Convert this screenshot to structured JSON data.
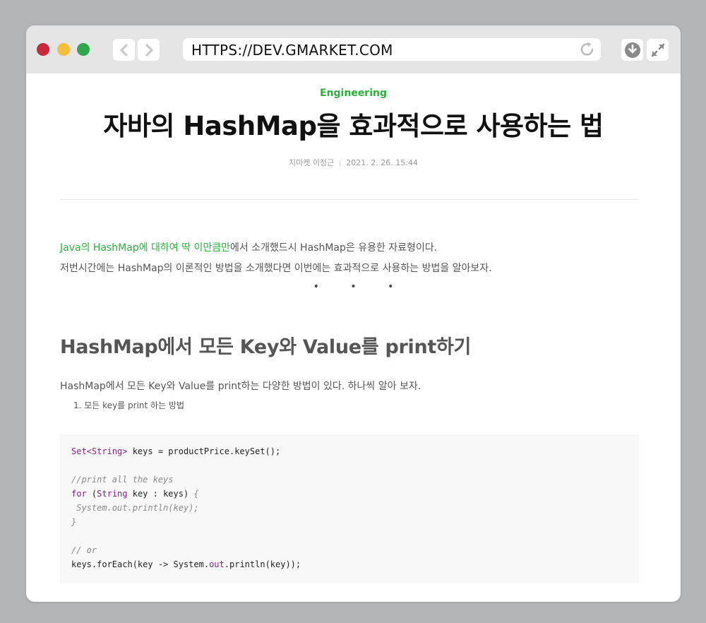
{
  "browser": {
    "url": "HTTPS://DEV.GMARKET.COM",
    "colors": {
      "chrome": "#e5e5e5",
      "close": "#c8283a",
      "minimize": "#f7bd3c",
      "maximize": "#2ea84a"
    },
    "icons": [
      "back-arrow-icon",
      "forward-arrow-icon",
      "reload-icon",
      "download-icon",
      "expand-icon"
    ]
  },
  "article": {
    "category": "Engineering",
    "title": "자바의 HashMap을 효과적으로 사용하는 법",
    "author": "지마켓 이정근",
    "date": "2021. 2. 26. 15:44",
    "intro_link": "Java의 HashMap에 대하여 딱 이만큼만",
    "intro_line1_rest": "에서 소개했드시 HashMap은 유용한 자료형이다.",
    "intro_line2": "저번시간에는 HashMap의 이론적인 방법을 소개했다면 이번에는 효과적으로 사용하는 방법을 알아보자.",
    "separator": "• • •",
    "section_heading": "HashMap에서 모든 Key와 Value를 print하기",
    "section_paragraph": "HashMap에서 모든 Key와 Value를 print하는 다양한 방법이 있다. 하나씩 알아 보자.",
    "list_item_1": "1. 모든 key를 print 하는 방법",
    "accent_color": "#2ab03c"
  },
  "code": {
    "l1_kw1": "Set",
    "l1_kw2": "<String>",
    "l1_rest": " keys = productPrice.keySet();",
    "l3": "//print all the keys",
    "l4_kw1": "for",
    "l4_a": " (",
    "l4_kw2": "String",
    "l4_b": " key : keys) ",
    "l4_c": "{",
    "l5": " System.out.println(key);",
    "l6": "}",
    "l8": "// or",
    "l9_a": "keys.forEach(key -> System.",
    "l9_kw": "out",
    "l9_b": ".println(key));"
  }
}
